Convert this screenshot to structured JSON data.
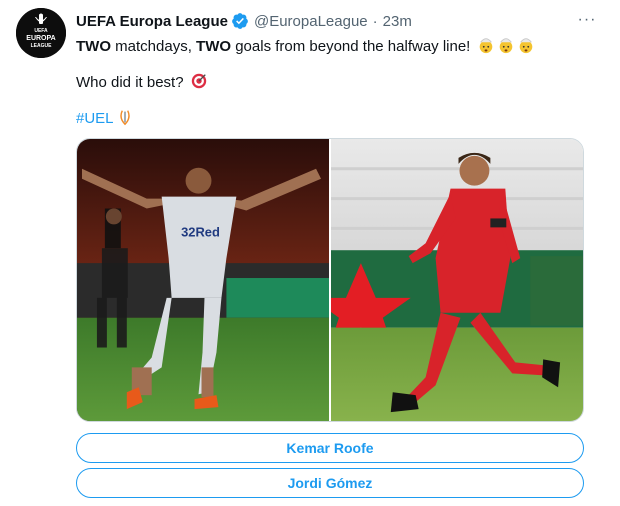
{
  "account": {
    "name": "UEFA Europa League",
    "handle": "@EuropaLeague",
    "separator": "·",
    "time": "23m",
    "avatar_text": [
      "UEFA",
      "EUROPA",
      "LEAGUE"
    ],
    "verified_icon": "verified-badge-icon"
  },
  "tweet": {
    "line1_parts": [
      "TWO",
      " matchdays, ",
      "TWO",
      " goals from beyond the halfway line! "
    ],
    "line2": "Who did it best? ",
    "hashtag": "#UEL"
  },
  "more_label": "···",
  "photos": [
    {
      "alt": "player-celebrating-photo",
      "shirt_text": "32Red"
    },
    {
      "alt": "player-running-photo"
    }
  ],
  "poll": {
    "options": [
      "Kemar Roofe",
      "Jordi Gómez"
    ]
  },
  "colors": {
    "accent": "#1d9bf0",
    "text": "#0f1419",
    "secondary": "#536471",
    "border": "#cfd9de"
  }
}
